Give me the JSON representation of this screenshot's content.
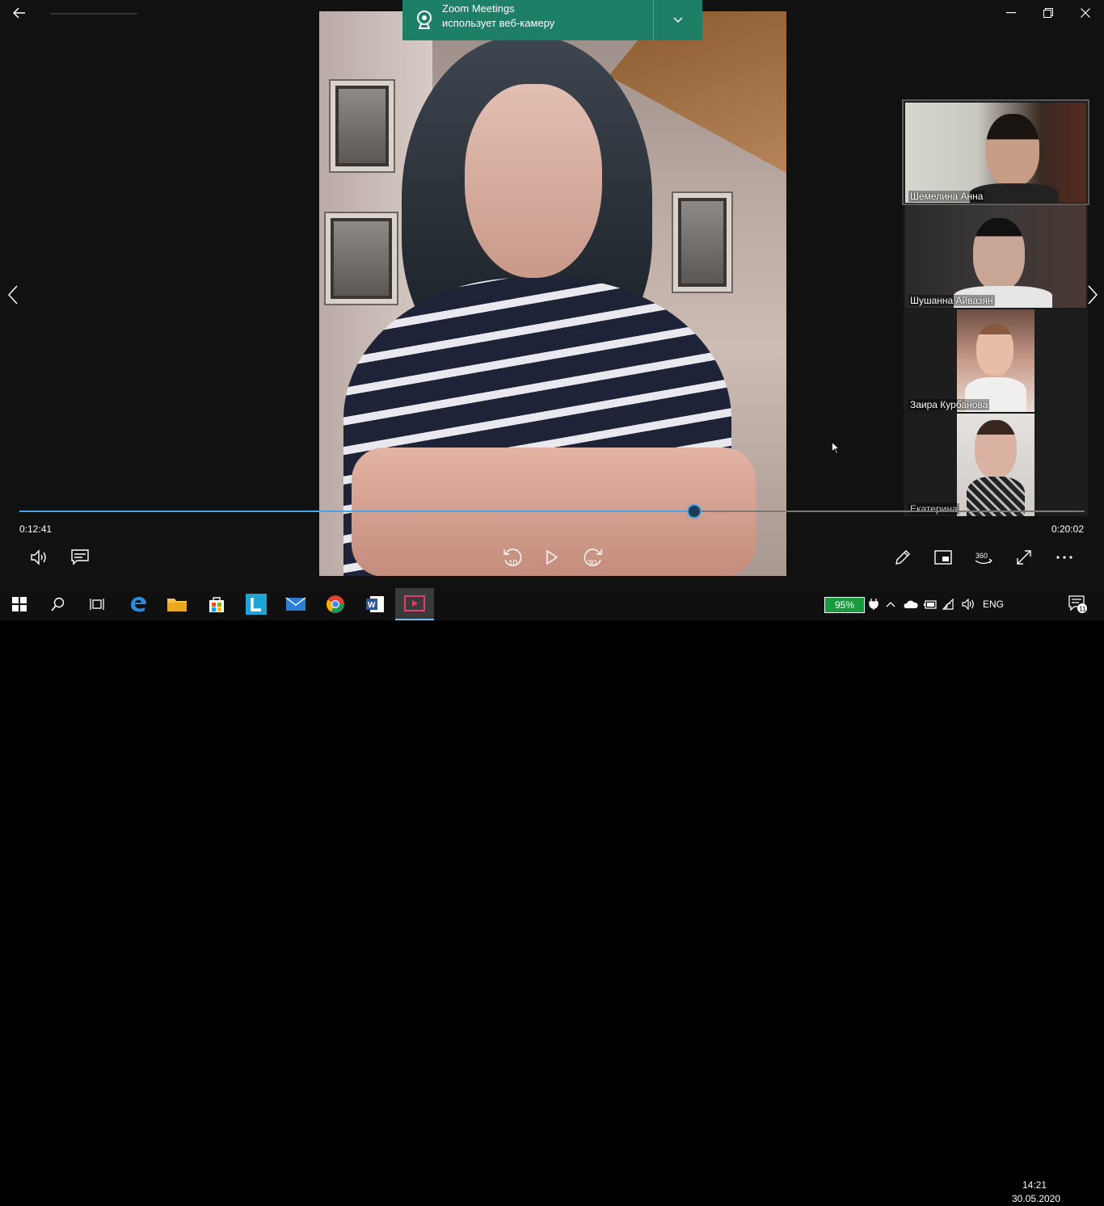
{
  "toast": {
    "line1": "Zoom Meetings",
    "line2": "использует веб-камеру"
  },
  "gallery": {
    "participants": [
      {
        "name": "Шемелина Анна"
      },
      {
        "name": "Шушанна Айвазян"
      },
      {
        "name": "Заира Курбанова"
      },
      {
        "name": "Екатерина"
      }
    ]
  },
  "player": {
    "current_time": "0:12:41",
    "total_time": "0:20:02",
    "progress": 0.6336,
    "skip_back_label": "10",
    "skip_forward_label": "30"
  },
  "taskbar": {
    "battery": "95%",
    "language": "ENG",
    "time": "14:21",
    "date": "30.05.2020",
    "notification_count": "11"
  },
  "colors": {
    "accent": "#4aa3e8",
    "toast_bg": "#1c7f66",
    "battery_green": "#1a9a3e"
  }
}
